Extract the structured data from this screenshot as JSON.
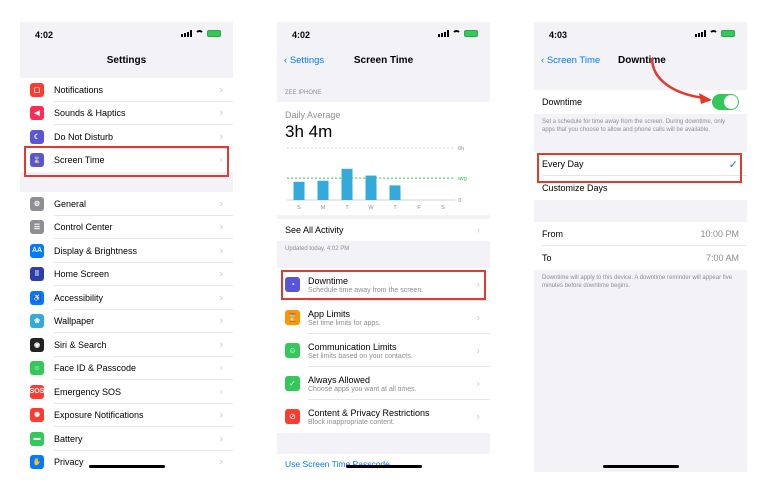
{
  "settings": {
    "status_time": "4:02",
    "title": "Settings",
    "group1": [
      {
        "label": "Notifications",
        "color": "#ff3b30",
        "glyph": "▢"
      },
      {
        "label": "Sounds & Haptics",
        "color": "#ff2d55",
        "glyph": "◀"
      },
      {
        "label": "Do Not Disturb",
        "color": "#5856d6",
        "glyph": "☾"
      },
      {
        "label": "Screen Time",
        "color": "#5856d6",
        "glyph": "⌛"
      }
    ],
    "group2": [
      {
        "label": "General",
        "color": "#8e8e93",
        "glyph": "⚙"
      },
      {
        "label": "Control Center",
        "color": "#8e8e93",
        "glyph": "☰"
      },
      {
        "label": "Display & Brightness",
        "color": "#007aff",
        "glyph": "AA"
      },
      {
        "label": "Home Screen",
        "color": "#2c3ea8",
        "glyph": "⠿"
      },
      {
        "label": "Accessibility",
        "color": "#007aff",
        "glyph": "♿"
      },
      {
        "label": "Wallpaper",
        "color": "#34aadc",
        "glyph": "❀"
      },
      {
        "label": "Siri & Search",
        "color": "#222222",
        "glyph": "◉"
      },
      {
        "label": "Face ID & Passcode",
        "color": "#34c759",
        "glyph": "☺"
      },
      {
        "label": "Emergency SOS",
        "color": "#ff3b30",
        "glyph": "SOS"
      },
      {
        "label": "Exposure Notifications",
        "color": "#ff3b30",
        "glyph": "✺"
      },
      {
        "label": "Battery",
        "color": "#34c759",
        "glyph": "▬"
      },
      {
        "label": "Privacy",
        "color": "#007aff",
        "glyph": "✋"
      }
    ]
  },
  "screen_time": {
    "status_time": "4:02",
    "back_label": "Settings",
    "title": "Screen Time",
    "device_label": "ZEE IPHONE",
    "daily_avg_label": "Daily Average",
    "daily_avg_value": "3h 4m",
    "chart_max_label": "6h",
    "chart_avg_label": "avg",
    "chart_min_label": "0",
    "day_labels": [
      "S",
      "M",
      "T",
      "W",
      "T",
      "F",
      "S"
    ],
    "bar_fractions": [
      0.35,
      0.37,
      0.6,
      0.47,
      0.28,
      0,
      0
    ],
    "avg_fraction": 0.42,
    "see_all_label": "See All Activity",
    "updated_label": "Updated today, 4:02 PM",
    "items": [
      {
        "title": "Downtime",
        "subtitle": "Schedule time away from the screen.",
        "color": "#5856d6",
        "glyph": "◔"
      },
      {
        "title": "App Limits",
        "subtitle": "Set time limits for apps.",
        "color": "#ff9500",
        "glyph": "⌛"
      },
      {
        "title": "Communication Limits",
        "subtitle": "Set limits based on your contacts.",
        "color": "#34c759",
        "glyph": "☺"
      },
      {
        "title": "Always Allowed",
        "subtitle": "Choose apps you want at all times.",
        "color": "#34c759",
        "glyph": "✓"
      },
      {
        "title": "Content & Privacy Restrictions",
        "subtitle": "Block inappropriate content.",
        "color": "#ff3b30",
        "glyph": "⊘"
      }
    ],
    "passcode_link": "Use Screen Time Passcode"
  },
  "downtime": {
    "status_time": "4:03",
    "back_label": "Screen Time",
    "title": "Downtime",
    "toggle_label": "Downtime",
    "toggle_on": true,
    "description": "Set a schedule for time away from the screen. During downtime, only apps that you choose to allow and phone calls will be available.",
    "every_day_label": "Every Day",
    "customize_label": "Customize Days",
    "from_label": "From",
    "from_value": "10:00 PM",
    "to_label": "To",
    "to_value": "7:00 AM",
    "footer": "Downtime will apply to this device. A downtime reminder will appear five minutes before downtime begins."
  }
}
